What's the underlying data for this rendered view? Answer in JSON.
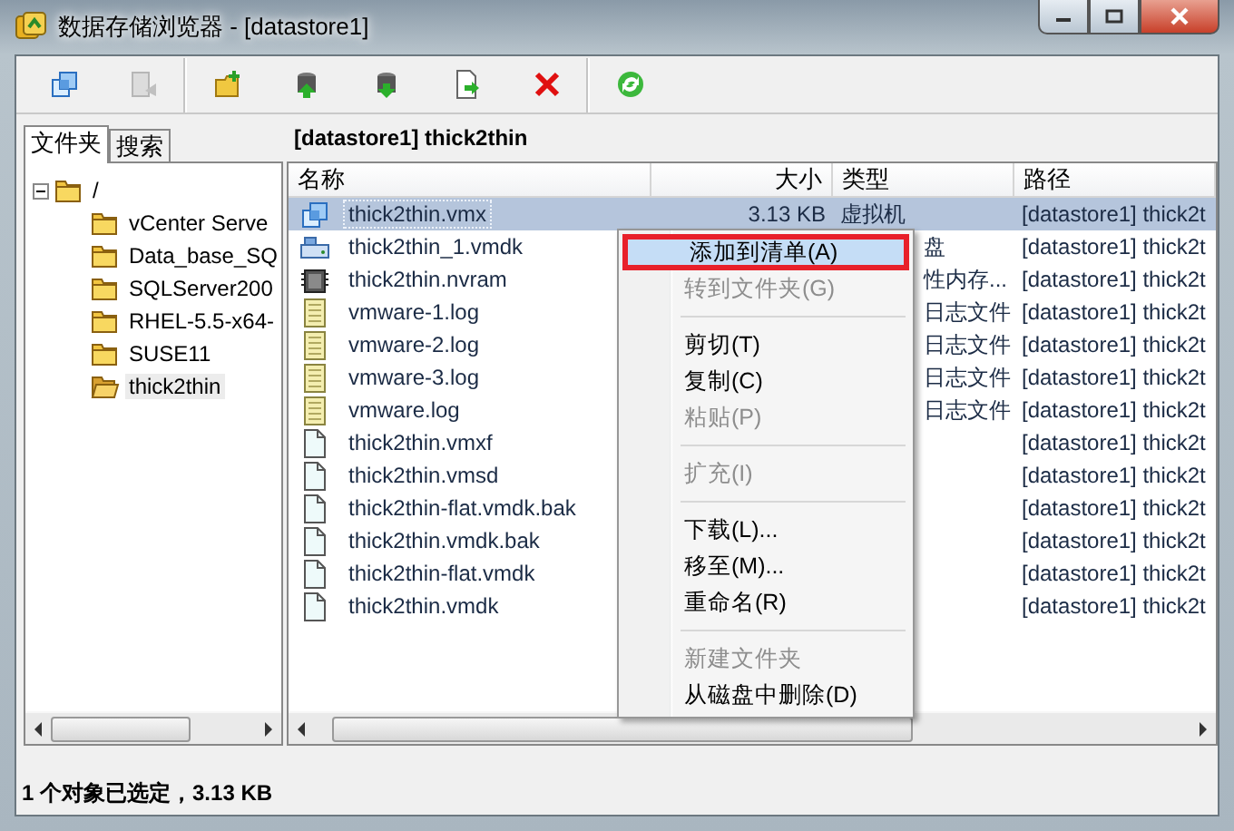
{
  "window": {
    "title": "数据存储浏览器 - [datastore1]"
  },
  "toolbar": [
    {
      "kind": "vm",
      "disabled": false
    },
    {
      "kind": "back",
      "disabled": true
    },
    {
      "kind": "sep"
    },
    {
      "kind": "newfolder",
      "disabled": false
    },
    {
      "kind": "upload",
      "disabled": false
    },
    {
      "kind": "download",
      "disabled": false
    },
    {
      "kind": "move",
      "disabled": false
    },
    {
      "kind": "delete",
      "disabled": false
    },
    {
      "kind": "sep"
    },
    {
      "kind": "refresh",
      "disabled": false
    }
  ],
  "tabs": [
    {
      "label": "文件夹",
      "selected": true
    },
    {
      "label": "搜索",
      "selected": false
    }
  ],
  "tree": [
    {
      "label": "/",
      "expanded": true,
      "selected": false,
      "children": [
        {
          "label": "vCenter Serve",
          "selected": false
        },
        {
          "label": "Data_base_SQ",
          "selected": false
        },
        {
          "label": "SQLServer200",
          "selected": false
        },
        {
          "label": "RHEL-5.5-x64-",
          "selected": false
        },
        {
          "label": "SUSE11",
          "selected": false
        },
        {
          "label": "thick2thin",
          "selected": true
        }
      ]
    }
  ],
  "path_label": "[datastore1] thick2thin",
  "table": {
    "columns": [
      "名称",
      "大小",
      "类型",
      "路径"
    ],
    "rows": [
      {
        "kind": "vm",
        "name": "thick2thin.vmx",
        "size": "3.13 KB",
        "type": "虚拟机",
        "path": "[datastore1] thick2t",
        "selected": true
      },
      {
        "kind": "disk",
        "name": "thick2thin_1.vmdk",
        "type": "盘",
        "path": "[datastore1] thick2t",
        "selected": false
      },
      {
        "kind": "nvram",
        "name": "thick2thin.nvram",
        "type": "性内存...",
        "path": "[datastore1] thick2t",
        "selected": false
      },
      {
        "kind": "log",
        "name": "vmware-1.log",
        "type": "日志文件",
        "path": "[datastore1] thick2t",
        "selected": false
      },
      {
        "kind": "log",
        "name": "vmware-2.log",
        "type": "日志文件",
        "path": "[datastore1] thick2t",
        "selected": false
      },
      {
        "kind": "log",
        "name": "vmware-3.log",
        "type": "日志文件",
        "path": "[datastore1] thick2t",
        "selected": false
      },
      {
        "kind": "log",
        "name": "vmware.log",
        "type": "日志文件",
        "path": "[datastore1] thick2t",
        "selected": false
      },
      {
        "kind": "file",
        "name": "thick2thin.vmxf",
        "path": "[datastore1] thick2t",
        "selected": false
      },
      {
        "kind": "file",
        "name": "thick2thin.vmsd",
        "path": "[datastore1] thick2t",
        "selected": false
      },
      {
        "kind": "file",
        "name": "thick2thin-flat.vmdk.bak",
        "path": "[datastore1] thick2t",
        "selected": false
      },
      {
        "kind": "file",
        "name": "thick2thin.vmdk.bak",
        "path": "[datastore1] thick2t",
        "selected": false
      },
      {
        "kind": "file",
        "name": "thick2thin-flat.vmdk",
        "path": "[datastore1] thick2t",
        "selected": false
      },
      {
        "kind": "file",
        "name": "thick2thin.vmdk",
        "path": "[datastore1] thick2t",
        "selected": false
      }
    ]
  },
  "context_menu": [
    {
      "kind": "item",
      "label": "添加到清单(A)",
      "disabled": false,
      "selected": true,
      "outlined": true
    },
    {
      "kind": "item",
      "label": "转到文件夹(G)",
      "disabled": true,
      "selected": false,
      "outlined": false
    },
    {
      "kind": "separator"
    },
    {
      "kind": "item",
      "label": "剪切(T)",
      "disabled": false,
      "selected": false,
      "outlined": false
    },
    {
      "kind": "item",
      "label": "复制(C)",
      "disabled": false,
      "selected": false,
      "outlined": false
    },
    {
      "kind": "item",
      "label": "粘贴(P)",
      "disabled": true,
      "selected": false,
      "outlined": false
    },
    {
      "kind": "separator"
    },
    {
      "kind": "item",
      "label": "扩充(I)",
      "disabled": true,
      "selected": false,
      "outlined": false
    },
    {
      "kind": "separator"
    },
    {
      "kind": "item",
      "label": "下载(L)...",
      "disabled": false,
      "selected": false,
      "outlined": false
    },
    {
      "kind": "item",
      "label": "移至(M)...",
      "disabled": false,
      "selected": false,
      "outlined": false
    },
    {
      "kind": "item",
      "label": "重命名(R)",
      "disabled": false,
      "selected": false,
      "outlined": false
    },
    {
      "kind": "separator"
    },
    {
      "kind": "item",
      "label": "新建文件夹",
      "disabled": true,
      "selected": false,
      "outlined": false
    },
    {
      "kind": "item",
      "label": "从磁盘中删除(D)",
      "disabled": false,
      "selected": false,
      "outlined": false
    }
  ],
  "status_bar": "1 个对象已选定，3.13 KB"
}
